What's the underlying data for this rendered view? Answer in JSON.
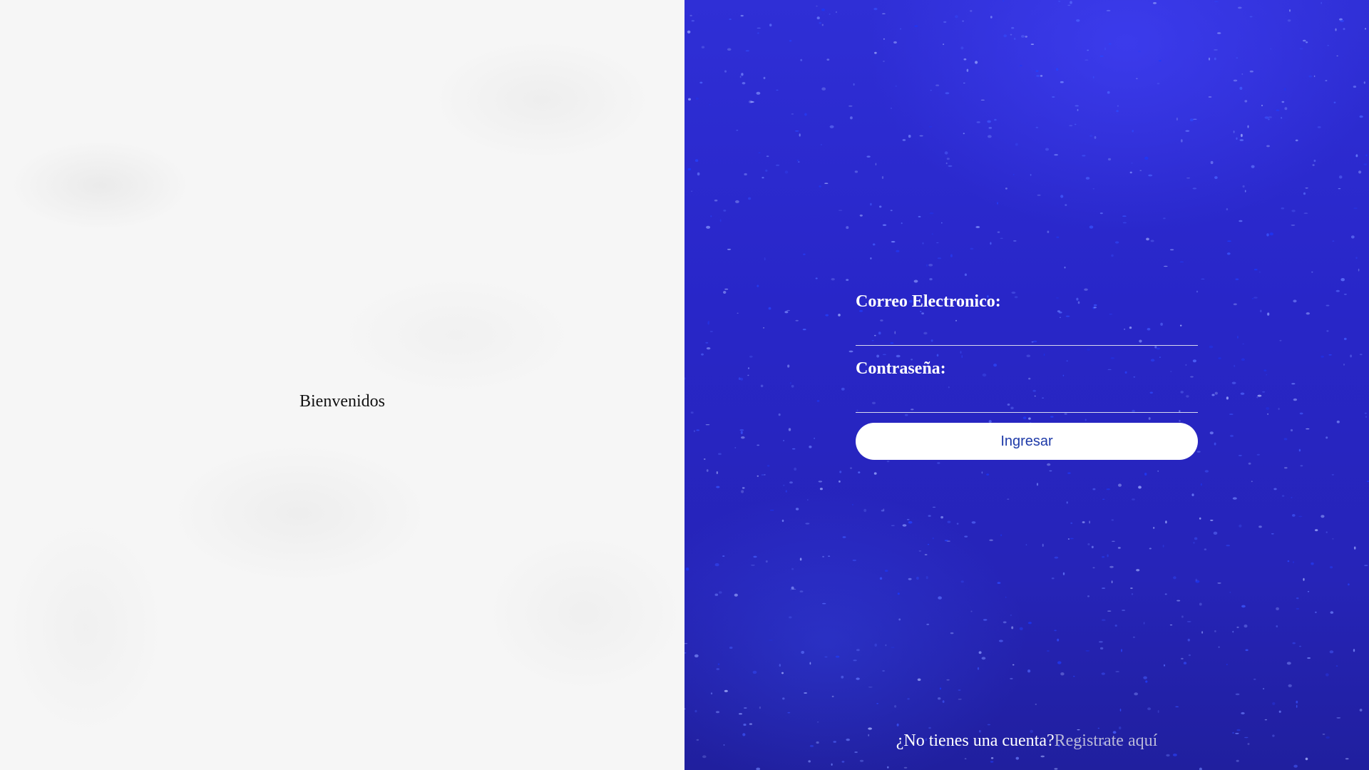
{
  "welcome": {
    "text": "Bienvenidos"
  },
  "login": {
    "email_label": "Correo Electronico:",
    "email_value": "",
    "password_label": "Contraseña:",
    "password_value": "",
    "submit_label": "Ingresar"
  },
  "register": {
    "prompt": "¿No tienes una cuenta?",
    "link_label": "Registrate aquí"
  },
  "colors": {
    "right_panel_bg": "#2a28c8",
    "left_panel_bg": "#f6f6f6",
    "button_bg": "#ffffff",
    "button_text": "#1e3aa8",
    "link_text": "#b9b9d8"
  }
}
